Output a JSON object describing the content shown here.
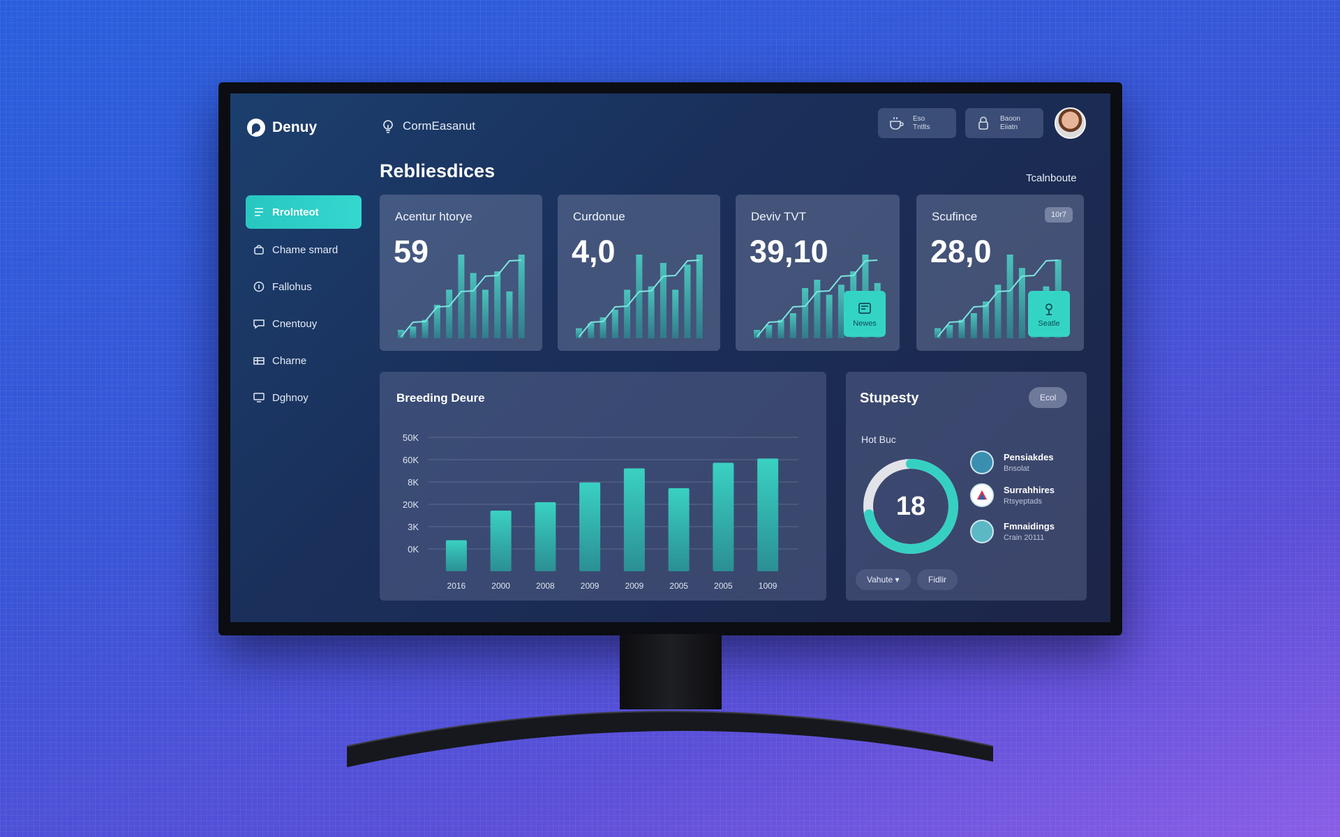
{
  "brand": {
    "name": "Denuy",
    "breadcrumb": "CormEasanut"
  },
  "header": {
    "btn1": {
      "line1": "Eso",
      "line2": "Tntlts"
    },
    "btn2": {
      "line1": "Baoon",
      "line2": "Eiiatn"
    }
  },
  "page": {
    "title": "Rebliesdices",
    "top_link": "Tcalnboute"
  },
  "sidebar": {
    "items": [
      {
        "label": "Rrolnteot",
        "icon": "list-icon",
        "active": true
      },
      {
        "label": "Chame smard",
        "icon": "bag-icon"
      },
      {
        "label": "Fallohus",
        "icon": "circle-info-icon"
      },
      {
        "label": "Cnentouy",
        "icon": "chat-icon"
      },
      {
        "label": "Charne",
        "icon": "table-icon"
      },
      {
        "label": "Dghnoy",
        "icon": "screen-icon"
      }
    ]
  },
  "stats": [
    {
      "label": "Acentur htorye",
      "value": "59"
    },
    {
      "label": "Curdonue",
      "value": "4,0"
    },
    {
      "label": "Deviv TVT",
      "value": "39,10",
      "tile": "Newes"
    },
    {
      "label": "Scufince",
      "value": "28,0",
      "badge": "10r7",
      "tile": "Seatle"
    }
  ],
  "chart_data": {
    "type": "bar",
    "title": "Breeding Deure",
    "categories": [
      "2016",
      "2000",
      "2008",
      "2009",
      "2009",
      "2005",
      "2005",
      "1009"
    ],
    "y_ticks": [
      "50K",
      "60K",
      "8K",
      "20K",
      "3K",
      "0K"
    ],
    "values": [
      22,
      43,
      49,
      63,
      73,
      59,
      77,
      80
    ],
    "ylim": [
      0,
      100
    ],
    "grid": true
  },
  "gauge": {
    "title": "Stupesty",
    "button": "Ecol",
    "sub_label": "Hot Buc",
    "value": "18",
    "fraction": 0.72,
    "legend": [
      {
        "name": "Pensiakdes",
        "desc": "Bnsolat"
      },
      {
        "name": "Surrahhires",
        "desc": "Rtsyeptads"
      },
      {
        "name": "Fmnaidings",
        "desc": "Crain 20111"
      }
    ],
    "footer_left": "Vahute",
    "footer_right": "Fidlir"
  },
  "colors": {
    "accent": "#34d4c4",
    "bar_top": "#3ad1c2",
    "bar_bottom": "#2b8f94"
  }
}
